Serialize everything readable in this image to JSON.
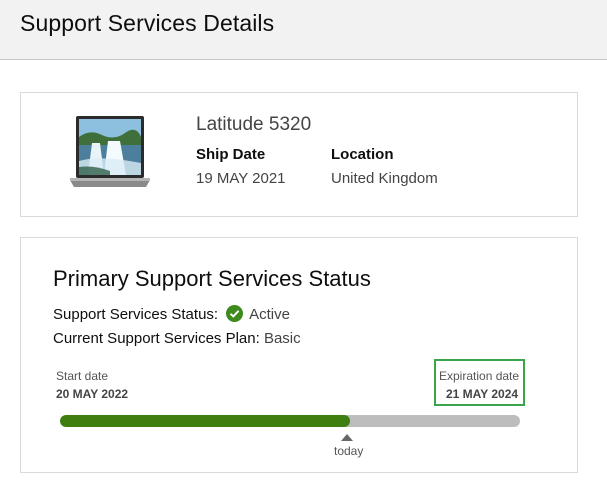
{
  "header": {
    "title": "Support Services Details"
  },
  "product": {
    "name": "Latitude 5320",
    "ship_date_label": "Ship Date",
    "ship_date": "19 MAY 2021",
    "location_label": "Location",
    "location": "United Kingdom",
    "image_icon": "laptop-image"
  },
  "status": {
    "title": "Primary Support Services Status",
    "status_label": "Support Services Status:",
    "status_value": "Active",
    "status_icon": "check-circle-icon",
    "plan_label": "Current Support Services Plan:",
    "plan_value": "Basic",
    "start_label": "Start date",
    "start_date": "20 MAY 2022",
    "expiration_label": "Expiration date",
    "expiration_date": "21 MAY 2024",
    "today_label": "today",
    "progress_fraction": 0.63
  },
  "colors": {
    "accent_green": "#3f7f10",
    "highlight_green": "#3aa64c",
    "track_gray": "#bdbdbd"
  }
}
